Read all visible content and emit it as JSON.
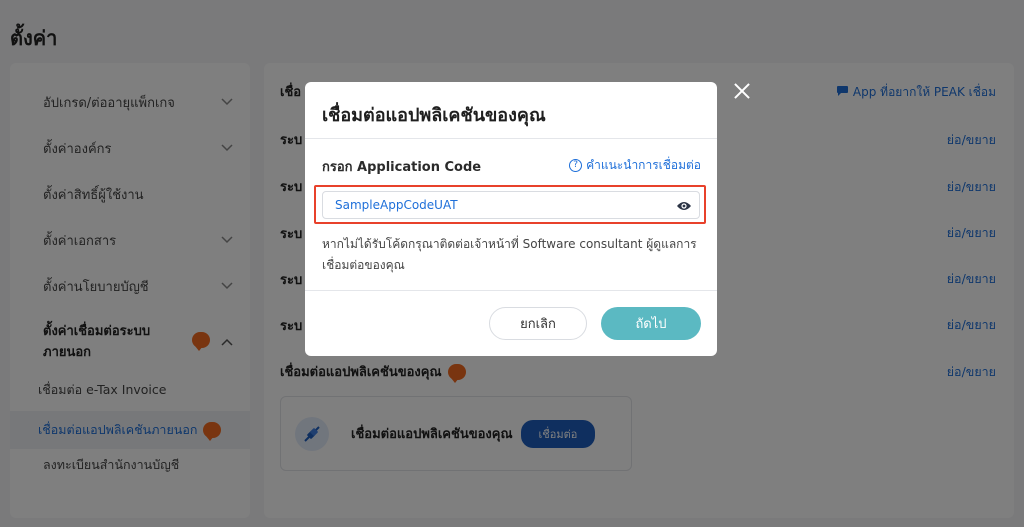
{
  "page": {
    "title": "ตั้งค่า"
  },
  "sidebar": {
    "items": [
      {
        "label": "อัปเกรด/ต่ออายุแพ็กเกจ"
      },
      {
        "label": "ตั้งค่าองค์กร"
      },
      {
        "label": "ตั้งค่าสิทธิ์ผู้ใช้งาน"
      },
      {
        "label": "ตั้งค่าเอกสาร"
      },
      {
        "label": "ตั้งค่านโยบายบัญชี"
      },
      {
        "label_line1": "ตั้งค่าเชื่อมต่อระบบ",
        "label_line2": "ภายนอก"
      }
    ],
    "subitems": [
      {
        "label": "เชื่อมต่อ e-Tax Invoice"
      },
      {
        "label": "เชื่อมต่อแอปพลิเคชันภายนอก"
      },
      {
        "label": "ลงทะเบียนสำนักงานบัญชี"
      }
    ]
  },
  "main": {
    "header_prefix": "เชื่อ",
    "app_link": "App ที่อยากให้ PEAK เชื่อม",
    "row_prefix": "ระบ",
    "toggle_label": "ย่อ/ขยาย",
    "section_title": "เชื่อมต่อแอปพลิเคชันของคุณ",
    "card_title": "เชื่อมต่อแอปพลิเคชันของคุณ",
    "card_button": "เชื่อมต่อ"
  },
  "modal": {
    "title": "เชื่อมต่อแอปพลิเคชันของคุณ",
    "field_label": "กรอก Application Code",
    "help_link": "คำแนะนำการเชื่อมต่อ",
    "input_value": "SampleAppCodeUAT",
    "hint": "หากไม่ได้รับโค้ดกรุณาติดต่อเจ้าหน้าที่ Software consultant ผู้ดูแลการเชื่อมต่อของคุณ",
    "cancel_label": "ยกเลิก",
    "next_label": "ถัดไป"
  },
  "colors": {
    "accent": "#1e6fd9",
    "badge": "#f26b21",
    "next_button": "#5bb9c2",
    "highlight": "#e8412b"
  }
}
